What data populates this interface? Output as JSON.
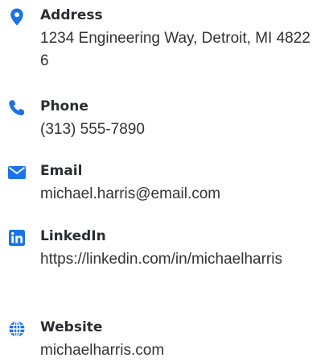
{
  "contact": {
    "accent_color": "#1a73e8",
    "items": [
      {
        "icon": "map-pin-icon",
        "label": "Address",
        "value": "1234 Engineering Way, Detroit, MI 48226"
      },
      {
        "icon": "phone-icon",
        "label": "Phone",
        "value": "(313) 555-7890"
      },
      {
        "icon": "envelope-icon",
        "label": "Email",
        "value": "michael.harris@email.com"
      },
      {
        "icon": "linkedin-icon",
        "label": "LinkedIn",
        "value": "https://linkedin.com/in/michaelharris"
      },
      {
        "icon": "globe-icon",
        "label": "Website",
        "value": "michaelharris.com"
      }
    ]
  }
}
